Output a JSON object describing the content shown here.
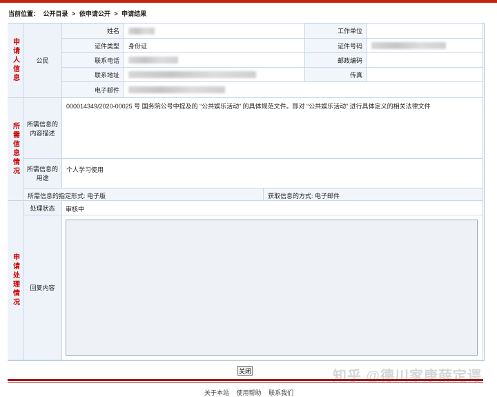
{
  "breadcrumb": {
    "prefix": "当前位置：",
    "items": [
      "公开目录",
      ">",
      "依申请公开",
      ">",
      "申请结果"
    ]
  },
  "applicant": {
    "section_title": "申请人信息",
    "type_label": "公民",
    "name_label": "姓名",
    "work_unit_label": "工作单位",
    "id_type_label": "证件类型",
    "id_type_value": "身份证",
    "id_number_label": "证件号码",
    "phone_label": "联系电话",
    "postcode_label": "邮政编码",
    "address_label": "联系地址",
    "fax_label": "传真",
    "email_label": "电子邮件"
  },
  "info_needed": {
    "section_title": "所需信息情况",
    "desc_label": "所需信息的内容描述",
    "desc_value": "000014349/2020-00025 号 国务院公号中提及的 “公共娱乐活动” 的具体规范文件。即对 “公共娱乐活动” 进行具体定义的相关法律文件",
    "purpose_label": "所需信息的用途",
    "purpose_value": "个人学习使用",
    "format_text": "所需信息的指定形式: 电子版",
    "method_text": "获取信息的方式: 电子邮件"
  },
  "processing": {
    "section_title": "申请处理情况",
    "status_label": "处理状态",
    "status_value": "审核中",
    "reply_label": "回复内容",
    "reply_value": ""
  },
  "close_button": "关闭",
  "footer": [
    "关于本站",
    "使用帮助",
    "联系我们"
  ],
  "watermark": "知乎 @德川家康薛定谔"
}
